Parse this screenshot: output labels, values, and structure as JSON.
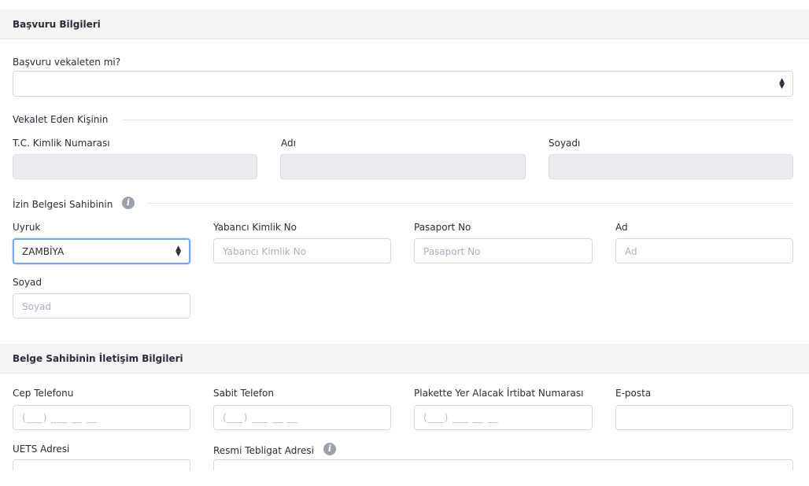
{
  "section1": {
    "title": "Başvuru Bilgileri"
  },
  "proxy_question": {
    "label": "Başvuru vekaleten mi?",
    "value": ""
  },
  "proxy_person": {
    "legend": "Vekalet Eden Kişinin",
    "tc_label": "T.C. Kimlik Numarası",
    "name_label": "Adı",
    "surname_label": "Soyadı"
  },
  "permit_owner": {
    "legend": "İzin Belgesi Sahibinin",
    "nationality_label": "Uyruk",
    "nationality_value": "ZAMBİYA",
    "foreign_id_label": "Yabancı Kimlik No",
    "foreign_id_placeholder": "Yabancı Kimlik No",
    "passport_label": "Pasaport No",
    "passport_placeholder": "Pasaport No",
    "name_label": "Ad",
    "name_placeholder": "Ad",
    "surname_label": "Soyad",
    "surname_placeholder": "Soyad"
  },
  "section2": {
    "title": "Belge Sahibinin İletişim Bilgileri"
  },
  "contact": {
    "mobile_label": "Cep Telefonu",
    "phone_mask": "(___) ___ __ __",
    "landline_label": "Sabit Telefon",
    "plate_phone_label": "Plakette Yer Alacak İrtibat Numarası",
    "email_label": "E-posta",
    "uets_label": "UETS Adresi",
    "official_address_label": "Resmi Tebligat Adresi"
  },
  "icons": {
    "info": "info-icon",
    "select_caret": "sort-caret-icon"
  }
}
